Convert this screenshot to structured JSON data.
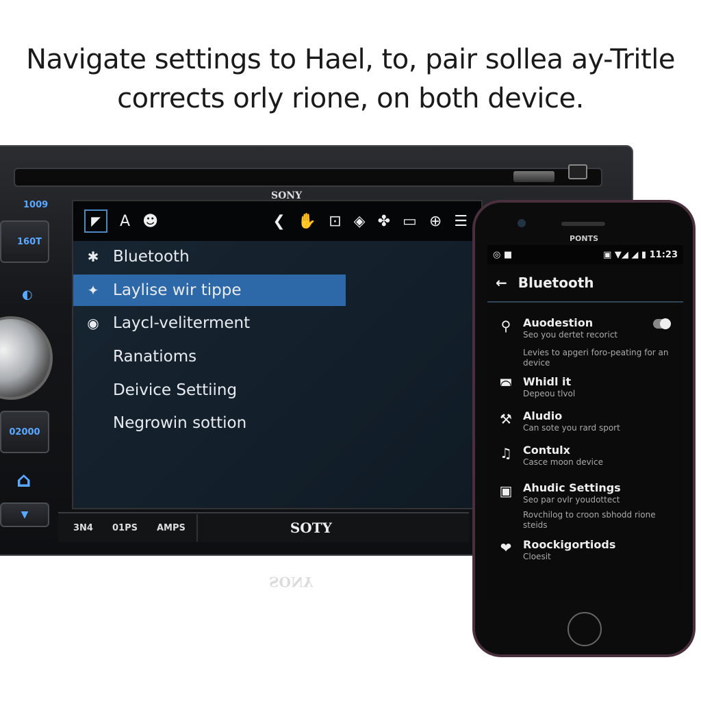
{
  "caption": {
    "line1": "Navigate settings to Hael, to, pair sollea ay-Tritle",
    "line2": "corrects orly rione, on both device."
  },
  "stereo": {
    "brand_top": "SONY",
    "brand_bottom": "SOTY",
    "brand_reflection": "SONY",
    "left_labels": [
      "1009",
      "160T",
      "02000"
    ],
    "topbar_icons": [
      "cursor-icon",
      "text-a-icon",
      "smiley-icon",
      "phone-icon",
      "hand-icon",
      "device-icon",
      "diamond-icon",
      "fan-icon",
      "monitor-icon",
      "globe-icon",
      "menu-icon"
    ],
    "topbar_glyphs": [
      "A",
      "☻",
      "❮",
      "✋",
      "⊡",
      "◈",
      "✤",
      "▭",
      "⊕",
      "☰"
    ],
    "menu": [
      {
        "icon": "bluetooth-icon",
        "glyph": "✱",
        "label": "Bluetooth",
        "selected": false
      },
      {
        "icon": "pin-icon",
        "glyph": "✦",
        "label": "Laylise wir tippe",
        "selected": true
      },
      {
        "icon": "record-icon",
        "glyph": "◉",
        "label": "Laycl-veliterment",
        "selected": false
      },
      {
        "icon": "",
        "glyph": "",
        "label": "Ranatioms",
        "selected": false
      },
      {
        "icon": "",
        "glyph": "",
        "label": "Deivice Settiing",
        "selected": false
      },
      {
        "icon": "",
        "glyph": "",
        "label": "Negrowin sottion",
        "selected": false
      }
    ],
    "bottom_labels": [
      "3N4",
      "01PS",
      "AMPS"
    ],
    "accent": "#2d68a8"
  },
  "phone": {
    "brand": "PONTS",
    "status": {
      "time": "11:23",
      "left": "◎ ■",
      "right": "▣ ▼◢ ◢ ▮"
    },
    "header": {
      "back": "←",
      "title": "Bluetooth"
    },
    "items": [
      {
        "icon": "palm-icon",
        "glyph": "⚲",
        "title": "Auodestion",
        "subtitle": "Seo you dertet recorict",
        "extra": "Levies to apgeri foro-peating for an device",
        "toggle": true
      },
      {
        "icon": "headset-icon",
        "glyph": "◚",
        "title": "Whidl it",
        "subtitle": "Depeou tlvol"
      },
      {
        "icon": "hammer-icon",
        "glyph": "⚒",
        "title": "Aludio",
        "subtitle": "Can sote you rard sport"
      },
      {
        "icon": "music-note-icon",
        "glyph": "♫",
        "title": "Contulx",
        "subtitle": "Casce moon device"
      },
      {
        "icon": "device-icon",
        "glyph": "▣",
        "title": "Ahudic Settings",
        "subtitle": "Seo par ovlr youdottect",
        "extra": "Rovchilog to croon sbhodd rione steids"
      },
      {
        "icon": "heart-icon",
        "glyph": "❤",
        "title": "Roockigortiods",
        "subtitle": "Cloesit"
      }
    ]
  }
}
